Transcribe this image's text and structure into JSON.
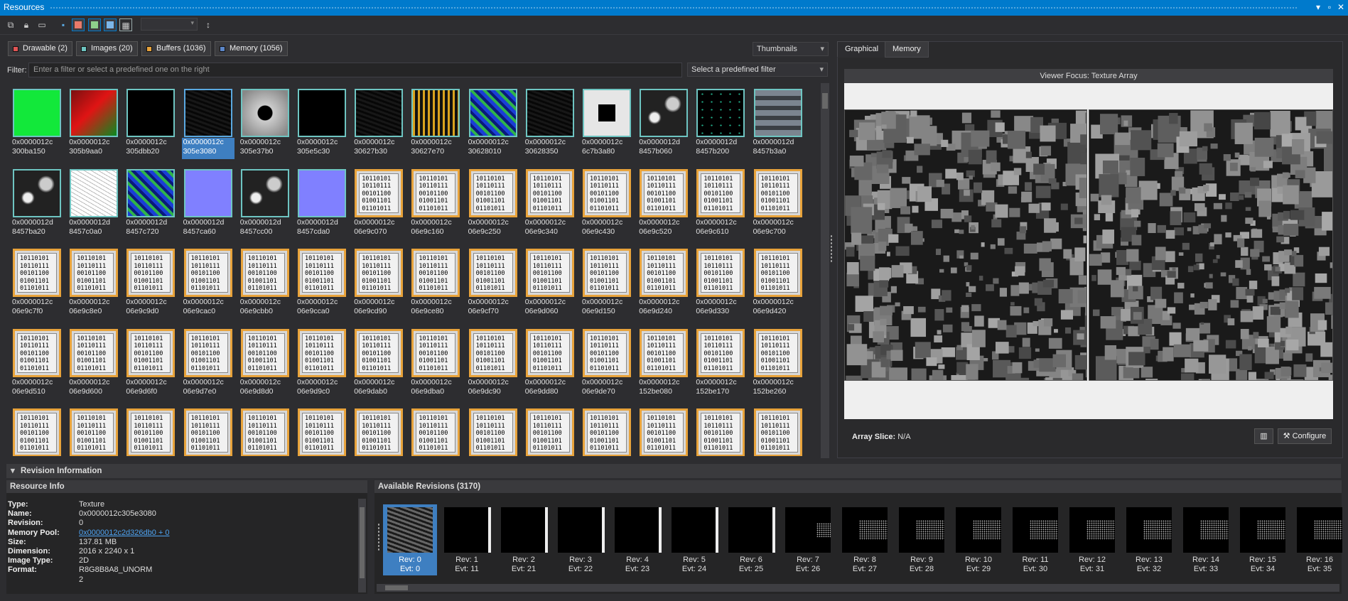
{
  "window": {
    "title": "Resources"
  },
  "toolbar": {
    "combo_value": ""
  },
  "type_tabs": [
    {
      "label": "Drawable (2)",
      "color": "#e05555"
    },
    {
      "label": "Images (20)",
      "color": "#6ec5c2"
    },
    {
      "label": "Buffers (1036)",
      "color": "#e8a33b"
    },
    {
      "label": "Memory (1056)",
      "color": "#5b86c8"
    }
  ],
  "view_mode": {
    "value": "Thumbnails"
  },
  "filter": {
    "label": "Filter:",
    "placeholder": "Enter a filter or select a predefined one on the right",
    "predefined": "Select a predefined filter"
  },
  "resources": [
    {
      "l1": "0x0000012c",
      "l2": "300ba150",
      "kind": "green"
    },
    {
      "l1": "0x0000012c",
      "l2": "305b9aa0",
      "kind": "redgrad"
    },
    {
      "l1": "0x0000012c",
      "l2": "305dbb20",
      "kind": "black"
    },
    {
      "l1": "0x0000012c",
      "l2": "305e3080",
      "kind": "cubes",
      "selected": true
    },
    {
      "l1": "0x0000012c",
      "l2": "305e37b0",
      "kind": "white-dark"
    },
    {
      "l1": "0x0000012c",
      "l2": "305e5c30",
      "kind": "black"
    },
    {
      "l1": "0x0000012c",
      "l2": "30627b30",
      "kind": "cubes"
    },
    {
      "l1": "0x0000012c",
      "l2": "30627e70",
      "kind": "yellow"
    },
    {
      "l1": "0x0000012c",
      "l2": "30628010",
      "kind": "bluegreen"
    },
    {
      "l1": "0x0000012c",
      "l2": "30628350",
      "kind": "cubes"
    },
    {
      "l1": "0x0000012c",
      "l2": "6c7b3a80",
      "kind": "white-hole"
    },
    {
      "l1": "0x0000012d",
      "l2": "8457b060",
      "kind": "mech"
    },
    {
      "l1": "0x0000012d",
      "l2": "8457b200",
      "kind": "dots"
    },
    {
      "l1": "0x0000012d",
      "l2": "8457b3a0",
      "kind": "atlas"
    },
    {
      "l1": "0x0000012d",
      "l2": "8457ba20",
      "kind": "mech"
    },
    {
      "l1": "0x0000012d",
      "l2": "8457c0a0",
      "kind": "sketch"
    },
    {
      "l1": "0x0000012d",
      "l2": "8457c720",
      "kind": "bluegreen"
    },
    {
      "l1": "0x0000012d",
      "l2": "8457ca60",
      "kind": "normal"
    },
    {
      "l1": "0x0000012d",
      "l2": "8457cc00",
      "kind": "mech"
    },
    {
      "l1": "0x0000012d",
      "l2": "8457cda0",
      "kind": "normal"
    },
    {
      "l1": "0x0000012c",
      "l2": "06e9c070",
      "kind": "buffer"
    },
    {
      "l1": "0x0000012c",
      "l2": "06e9c160",
      "kind": "buffer"
    },
    {
      "l1": "0x0000012c",
      "l2": "06e9c250",
      "kind": "buffer"
    },
    {
      "l1": "0x0000012c",
      "l2": "06e9c340",
      "kind": "buffer"
    },
    {
      "l1": "0x0000012c",
      "l2": "06e9c430",
      "kind": "buffer"
    },
    {
      "l1": "0x0000012c",
      "l2": "06e9c520",
      "kind": "buffer"
    },
    {
      "l1": "0x0000012c",
      "l2": "06e9c610",
      "kind": "buffer"
    },
    {
      "l1": "0x0000012c",
      "l2": "06e9c700",
      "kind": "buffer"
    },
    {
      "l1": "0x0000012c",
      "l2": "06e9c7f0",
      "kind": "buffer"
    },
    {
      "l1": "0x0000012c",
      "l2": "06e9c8e0",
      "kind": "buffer"
    },
    {
      "l1": "0x0000012c",
      "l2": "06e9c9d0",
      "kind": "buffer"
    },
    {
      "l1": "0x0000012c",
      "l2": "06e9cac0",
      "kind": "buffer"
    },
    {
      "l1": "0x0000012c",
      "l2": "06e9cbb0",
      "kind": "buffer"
    },
    {
      "l1": "0x0000012c",
      "l2": "06e9cca0",
      "kind": "buffer"
    },
    {
      "l1": "0x0000012c",
      "l2": "06e9cd90",
      "kind": "buffer"
    },
    {
      "l1": "0x0000012c",
      "l2": "06e9ce80",
      "kind": "buffer"
    },
    {
      "l1": "0x0000012c",
      "l2": "06e9cf70",
      "kind": "buffer"
    },
    {
      "l1": "0x0000012c",
      "l2": "06e9d060",
      "kind": "buffer"
    },
    {
      "l1": "0x0000012c",
      "l2": "06e9d150",
      "kind": "buffer"
    },
    {
      "l1": "0x0000012c",
      "l2": "06e9d240",
      "kind": "buffer"
    },
    {
      "l1": "0x0000012c",
      "l2": "06e9d330",
      "kind": "buffer"
    },
    {
      "l1": "0x0000012c",
      "l2": "06e9d420",
      "kind": "buffer"
    },
    {
      "l1": "0x0000012c",
      "l2": "06e9d510",
      "kind": "buffer"
    },
    {
      "l1": "0x0000012c",
      "l2": "06e9d600",
      "kind": "buffer"
    },
    {
      "l1": "0x0000012c",
      "l2": "06e9d6f0",
      "kind": "buffer"
    },
    {
      "l1": "0x0000012c",
      "l2": "06e9d7e0",
      "kind": "buffer"
    },
    {
      "l1": "0x0000012c",
      "l2": "06e9d8d0",
      "kind": "buffer"
    },
    {
      "l1": "0x0000012c",
      "l2": "06e9d9c0",
      "kind": "buffer"
    },
    {
      "l1": "0x0000012c",
      "l2": "06e9dab0",
      "kind": "buffer"
    },
    {
      "l1": "0x0000012c",
      "l2": "06e9dba0",
      "kind": "buffer"
    },
    {
      "l1": "0x0000012c",
      "l2": "06e9dc90",
      "kind": "buffer"
    },
    {
      "l1": "0x0000012c",
      "l2": "06e9dd80",
      "kind": "buffer"
    },
    {
      "l1": "0x0000012c",
      "l2": "06e9de70",
      "kind": "buffer"
    },
    {
      "l1": "0x0000012c",
      "l2": "152be080",
      "kind": "buffer"
    },
    {
      "l1": "0x0000012c",
      "l2": "152be170",
      "kind": "buffer"
    },
    {
      "l1": "0x0000012c",
      "l2": "152be260",
      "kind": "buffer"
    },
    {
      "l1": "",
      "l2": "",
      "kind": "buffer"
    },
    {
      "l1": "",
      "l2": "",
      "kind": "buffer"
    },
    {
      "l1": "",
      "l2": "",
      "kind": "buffer"
    },
    {
      "l1": "",
      "l2": "",
      "kind": "buffer"
    },
    {
      "l1": "",
      "l2": "",
      "kind": "buffer"
    },
    {
      "l1": "",
      "l2": "",
      "kind": "buffer"
    },
    {
      "l1": "",
      "l2": "",
      "kind": "buffer"
    },
    {
      "l1": "",
      "l2": "",
      "kind": "buffer"
    },
    {
      "l1": "",
      "l2": "",
      "kind": "buffer"
    },
    {
      "l1": "",
      "l2": "",
      "kind": "buffer"
    },
    {
      "l1": "",
      "l2": "",
      "kind": "buffer"
    },
    {
      "l1": "",
      "l2": "",
      "kind": "buffer"
    },
    {
      "l1": "",
      "l2": "",
      "kind": "buffer"
    },
    {
      "l1": "",
      "l2": "",
      "kind": "buffer"
    }
  ],
  "binary_text": "10110101\n10110111\n00101100\n01001101\n01101011",
  "viewer": {
    "tabs": [
      "Graphical",
      "Memory"
    ],
    "focus_title": "Viewer Focus: Texture Array",
    "array_slice_label": "Array Slice:",
    "array_slice_value": "N/A",
    "configure_label": "Configure",
    "chart_icon": "bar-chart-icon"
  },
  "revision_section": {
    "title": "Revision Information"
  },
  "resource_info": {
    "title": "Resource Info",
    "rows": [
      {
        "k": "Type:",
        "v": "Texture"
      },
      {
        "k": "Name:",
        "v": "0x0000012c305e3080"
      },
      {
        "k": "Revision:",
        "v": "0"
      },
      {
        "k": "Memory Pool:",
        "v": "0x0000012c2d326db0 + 0",
        "link": true
      },
      {
        "k": "Size:",
        "v": "137.81 MB"
      },
      {
        "k": "Dimension:",
        "v": "2016 x 2240 x 1"
      },
      {
        "k": "Image Type:",
        "v": "2D"
      },
      {
        "k": "Format:",
        "v": "R8G8B8A8_UNORM"
      },
      {
        "k": "",
        "v": "2"
      }
    ]
  },
  "revisions": {
    "title": "Available Revisions (3170)",
    "items": [
      {
        "rev": "Rev: 0",
        "evt": "Evt: 0",
        "kind": "cubes",
        "selected": true
      },
      {
        "rev": "Rev: 1",
        "evt": "Evt: 11",
        "kind": "black-bar"
      },
      {
        "rev": "Rev: 2",
        "evt": "Evt: 21",
        "kind": "black-bar"
      },
      {
        "rev": "Rev: 3",
        "evt": "Evt: 22",
        "kind": "black-bar"
      },
      {
        "rev": "Rev: 4",
        "evt": "Evt: 23",
        "kind": "black-bar"
      },
      {
        "rev": "Rev: 5",
        "evt": "Evt: 24",
        "kind": "black-bar"
      },
      {
        "rev": "Rev: 6",
        "evt": "Evt: 25",
        "kind": "black-bar"
      },
      {
        "rev": "Rev: 7",
        "evt": "Evt: 26",
        "kind": "noise-small"
      },
      {
        "rev": "Rev: 8",
        "evt": "Evt: 27",
        "kind": "noise"
      },
      {
        "rev": "Rev: 9",
        "evt": "Evt: 28",
        "kind": "noise"
      },
      {
        "rev": "Rev: 10",
        "evt": "Evt: 29",
        "kind": "noise"
      },
      {
        "rev": "Rev: 11",
        "evt": "Evt: 30",
        "kind": "noise"
      },
      {
        "rev": "Rev: 12",
        "evt": "Evt: 31",
        "kind": "noise"
      },
      {
        "rev": "Rev: 13",
        "evt": "Evt: 32",
        "kind": "noise"
      },
      {
        "rev": "Rev: 14",
        "evt": "Evt: 33",
        "kind": "noise"
      },
      {
        "rev": "Rev: 15",
        "evt": "Evt: 34",
        "kind": "noise"
      },
      {
        "rev": "Rev: 16",
        "evt": "Evt: 35",
        "kind": "noise"
      }
    ]
  }
}
